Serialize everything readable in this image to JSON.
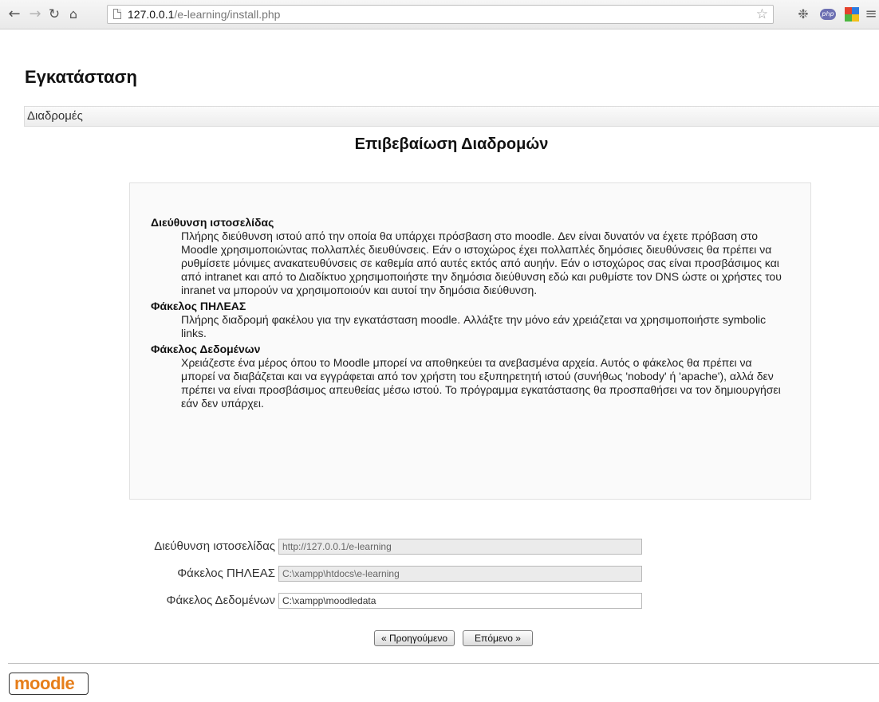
{
  "browser": {
    "url_host": "127.0.0.1",
    "url_path": "/e-learning/install.php",
    "ext_php_label": "php"
  },
  "page": {
    "title": "Εγκατάσταση",
    "breadcrumb": "Διαδρομές",
    "heading": "Επιβεβαίωση Διαδρομών"
  },
  "help": [
    {
      "term": "Διεύθυνση ιστοσελίδας",
      "description": "Πλήρης διεύθυνση ιστού από την οποία θα υπάρχει πρόσβαση στο moodle. Δεν είναι δυνατόν να έχετε πρόβαση στο Moodle χρησιμοποιώντας πολλαπλές διευθύνσεις. Εάν ο ιστοχώρος έχει πολλαπλές δημόσιες διευθύνσεις θα πρέπει να ρυθμίσετε μόνιμες ανακατευθύνσεις σε καθεμία από αυτές εκτός από αυηήν. Εάν ο ιστοχώρος σας είναι προσβάσιμος και από intranet και από το Διαδίκτυο χρησιμοποιήστε την δημόσια διεύθυνση εδώ και ρυθμίστε τον DNS ώστε οι χρήστες του inranet να μπορούν να χρησιμοποιούν και αυτοί την δημόσια διεύθυνση."
    },
    {
      "term": "Φάκελος ΠΗΛΕΑΣ",
      "description": "Πλήρης διαδρομή φακέλου για την εγκατάσταση moodle. Αλλάξτε την μόνο εάν χρειάζεται να χρησιμοποιήστε symbolic links."
    },
    {
      "term": "Φάκελος Δεδομένων",
      "description": "Χρειάζεστε ένα μέρος όπου το Moodle μπορεί να αποθηκεύει τα ανεβασμένα αρχεία. Αυτός ο φάκελος θα πρέπει να μπορεί να διαβάζεται και να εγγράφεται από τον χρήστη του εξυπηρετητή ιστού (συνήθως 'nobody' ή 'apache'), αλλά δεν πρέπει να είναι προσβάσιμος απευθείας μέσω ιστού. Το πρόγραμμα εγκατάστασης θα προσπαθήσει να τον δημιουργήσει εάν δεν υπάρχει."
    }
  ],
  "form": {
    "wwwroot_label": "Διεύθυνση ιστοσελίδας",
    "wwwroot_value": "http://127.0.0.1/e-learning",
    "dirroot_label": "Φάκελος ΠΗΛΕΑΣ",
    "dirroot_value": "C:\\xampp\\htdocs\\e-learning",
    "dataroot_label": "Φάκελος Δεδομένων",
    "dataroot_value": "C:\\xampp\\moodledata",
    "prev_button": "« Προηγούμενο",
    "next_button": "Επόμενο »"
  },
  "footer": {
    "logo_text": "moodle"
  }
}
